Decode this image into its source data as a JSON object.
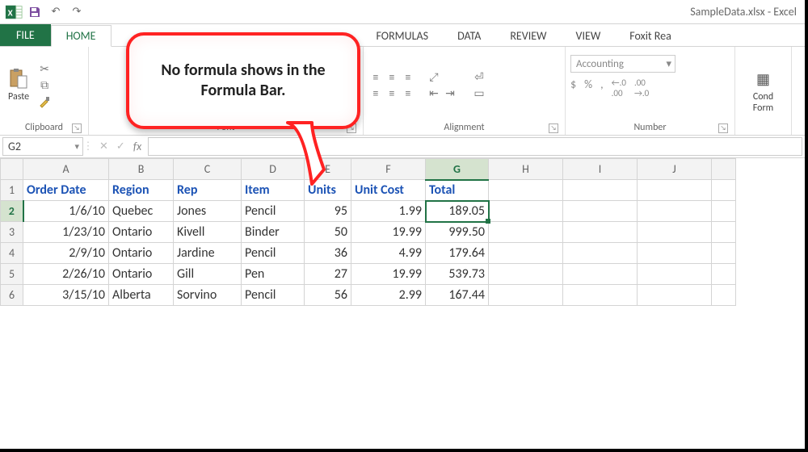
{
  "title": "SampleData.xlsx - Excel",
  "tabs": {
    "file": "FILE",
    "home": "HOME",
    "formulas": "FORMULAS",
    "data": "DATA",
    "review": "REVIEW",
    "view": "VIEW",
    "foxit": "Foxit Rea"
  },
  "ribbon": {
    "paste_label": "Paste",
    "clipboard_label": "Clipboard",
    "font_label": "Font",
    "alignment_label": "Alignment",
    "number_label": "Number",
    "number_format": "Accounting",
    "conditional_label": "Cond\nForm",
    "currency": "$",
    "percent": "%",
    "comma": ",",
    "inc_dec": ".0",
    "dec_inc": ".00"
  },
  "formula_bar": {
    "name_box": "G2",
    "fx": "fx",
    "value": ""
  },
  "columns": [
    "A",
    "B",
    "C",
    "D",
    "E",
    "F",
    "G",
    "H",
    "I",
    "J"
  ],
  "headers": [
    "Order Date",
    "Region",
    "Rep",
    "Item",
    "Units",
    "Unit Cost",
    "Total"
  ],
  "rows": [
    {
      "n": "1"
    },
    {
      "n": "2",
      "date": "1/6/10",
      "region": "Quebec",
      "rep": "Jones",
      "item": "Pencil",
      "units": "95",
      "cost": "1.99",
      "total": "189.05"
    },
    {
      "n": "3",
      "date": "1/23/10",
      "region": "Ontario",
      "rep": "Kivell",
      "item": "Binder",
      "units": "50",
      "cost": "19.99",
      "total": "999.50"
    },
    {
      "n": "4",
      "date": "2/9/10",
      "region": "Ontario",
      "rep": "Jardine",
      "item": "Pencil",
      "units": "36",
      "cost": "4.99",
      "total": "179.64"
    },
    {
      "n": "5",
      "date": "2/26/10",
      "region": "Ontario",
      "rep": "Gill",
      "item": "Pen",
      "units": "27",
      "cost": "19.99",
      "total": "539.73"
    },
    {
      "n": "6",
      "date": "3/15/10",
      "region": "Alberta",
      "rep": "Sorvino",
      "item": "Pencil",
      "units": "56",
      "cost": "2.99",
      "total": "167.44"
    }
  ],
  "callout": "No formula shows in the Formula Bar."
}
